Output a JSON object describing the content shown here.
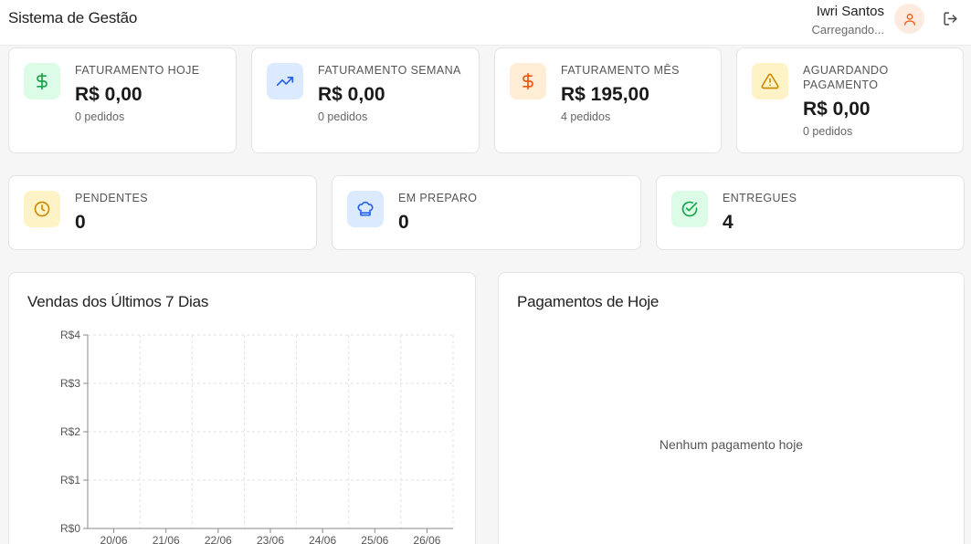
{
  "header": {
    "title": "Sistema de Gestão",
    "user_name": "Iwri Santos",
    "user_status": "Carregando..."
  },
  "stats_top": [
    {
      "label": "FATURAMENTO HOJE",
      "value": "R$ 0,00",
      "sub": "0 pedidos",
      "icon": "dollar-icon",
      "color": "#16a34a",
      "bg": "#dcfce7"
    },
    {
      "label": "FATURAMENTO SEMANA",
      "value": "R$ 0,00",
      "sub": "0 pedidos",
      "icon": "trending-up-icon",
      "color": "#2563eb",
      "bg": "#dbeafe"
    },
    {
      "label": "FATURAMENTO MÊS",
      "value": "R$ 195,00",
      "sub": "4 pedidos",
      "icon": "dollar-icon",
      "color": "#ea580c",
      "bg": "#ffedd5"
    },
    {
      "label": "AGUARDANDO PAGAMENTO",
      "value": "R$ 0,00",
      "sub": "0 pedidos",
      "icon": "warning-icon",
      "color": "#ca8a04",
      "bg": "#fef3c7"
    }
  ],
  "stats_orders": [
    {
      "label": "PENDENTES",
      "value": "0",
      "icon": "clock-icon",
      "color": "#ca8a04",
      "bg": "#fef3c7"
    },
    {
      "label": "EM PREPARO",
      "value": "0",
      "icon": "chef-hat-icon",
      "color": "#2563eb",
      "bg": "#dbeafe"
    },
    {
      "label": "ENTREGUES",
      "value": "4",
      "icon": "check-circle-icon",
      "color": "#16a34a",
      "bg": "#dcfce7"
    }
  ],
  "sales_panel": {
    "title": "Vendas dos Últimos 7 Dias"
  },
  "chart_data": {
    "type": "bar",
    "title": "Vendas dos Últimos 7 Dias",
    "categories": [
      "20/06",
      "21/06",
      "22/06",
      "23/06",
      "24/06",
      "25/06",
      "26/06"
    ],
    "values": [
      0,
      0,
      0,
      0,
      0,
      0,
      0
    ],
    "y_ticks": [
      "R$0",
      "R$1",
      "R$2",
      "R$3",
      "R$4"
    ],
    "ylim": [
      0,
      4
    ],
    "grid": true
  },
  "payments_panel": {
    "title": "Pagamentos de Hoje",
    "empty_message": "Nenhum pagamento hoje"
  }
}
